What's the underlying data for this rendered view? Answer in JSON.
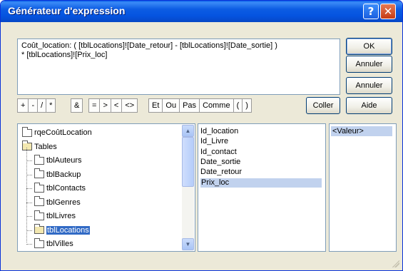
{
  "window": {
    "title": "Générateur d'expression",
    "help_glyph": "?",
    "close_glyph": "✕"
  },
  "expression": {
    "text": "Coût_location: ( [tblLocations]![Date_retour] - [tblLocations]![Date_sortie] )\n* [tblLocations]![Prix_loc]"
  },
  "buttons": {
    "ok": "OK",
    "cancel": "Annuler",
    "undo": "Annuler",
    "paste": "Coller",
    "help": "Aide"
  },
  "operators": {
    "arith": [
      "+",
      "-",
      "/",
      "*"
    ],
    "concat": [
      "&"
    ],
    "compare": [
      "=",
      ">",
      "<",
      "<>"
    ],
    "logic": [
      "Et",
      "Ou",
      "Pas",
      "Comme",
      "(",
      ")"
    ]
  },
  "tree": {
    "items": [
      {
        "label": "rqeCoûtLocation",
        "indent": 0,
        "folder_open": false,
        "selected": false
      },
      {
        "label": "Tables",
        "indent": 0,
        "folder_open": true,
        "selected": false
      },
      {
        "label": "tblAuteurs",
        "indent": 1,
        "folder_open": false,
        "selected": false
      },
      {
        "label": "tblBackup",
        "indent": 1,
        "folder_open": false,
        "selected": false
      },
      {
        "label": "tblContacts",
        "indent": 1,
        "folder_open": false,
        "selected": false
      },
      {
        "label": "tblGenres",
        "indent": 1,
        "folder_open": false,
        "selected": false
      },
      {
        "label": "tblLivres",
        "indent": 1,
        "folder_open": false,
        "selected": false
      },
      {
        "label": "tblLocations",
        "indent": 1,
        "folder_open": true,
        "selected": true
      },
      {
        "label": "tblVilles",
        "indent": 1,
        "folder_open": false,
        "selected": false
      }
    ]
  },
  "fields": {
    "items": [
      "Id_location",
      "Id_Livre",
      "Id_contact",
      "Date_sortie",
      "Date_retour",
      "Prix_loc"
    ],
    "selected": "Prix_loc"
  },
  "values": {
    "items": [
      "<Valeur>"
    ]
  },
  "colors": {
    "titlebar": "#0554e0",
    "selection": "#316ac5",
    "soft_selection": "#c1d2ee",
    "dialog_bg": "#ece9d8"
  }
}
